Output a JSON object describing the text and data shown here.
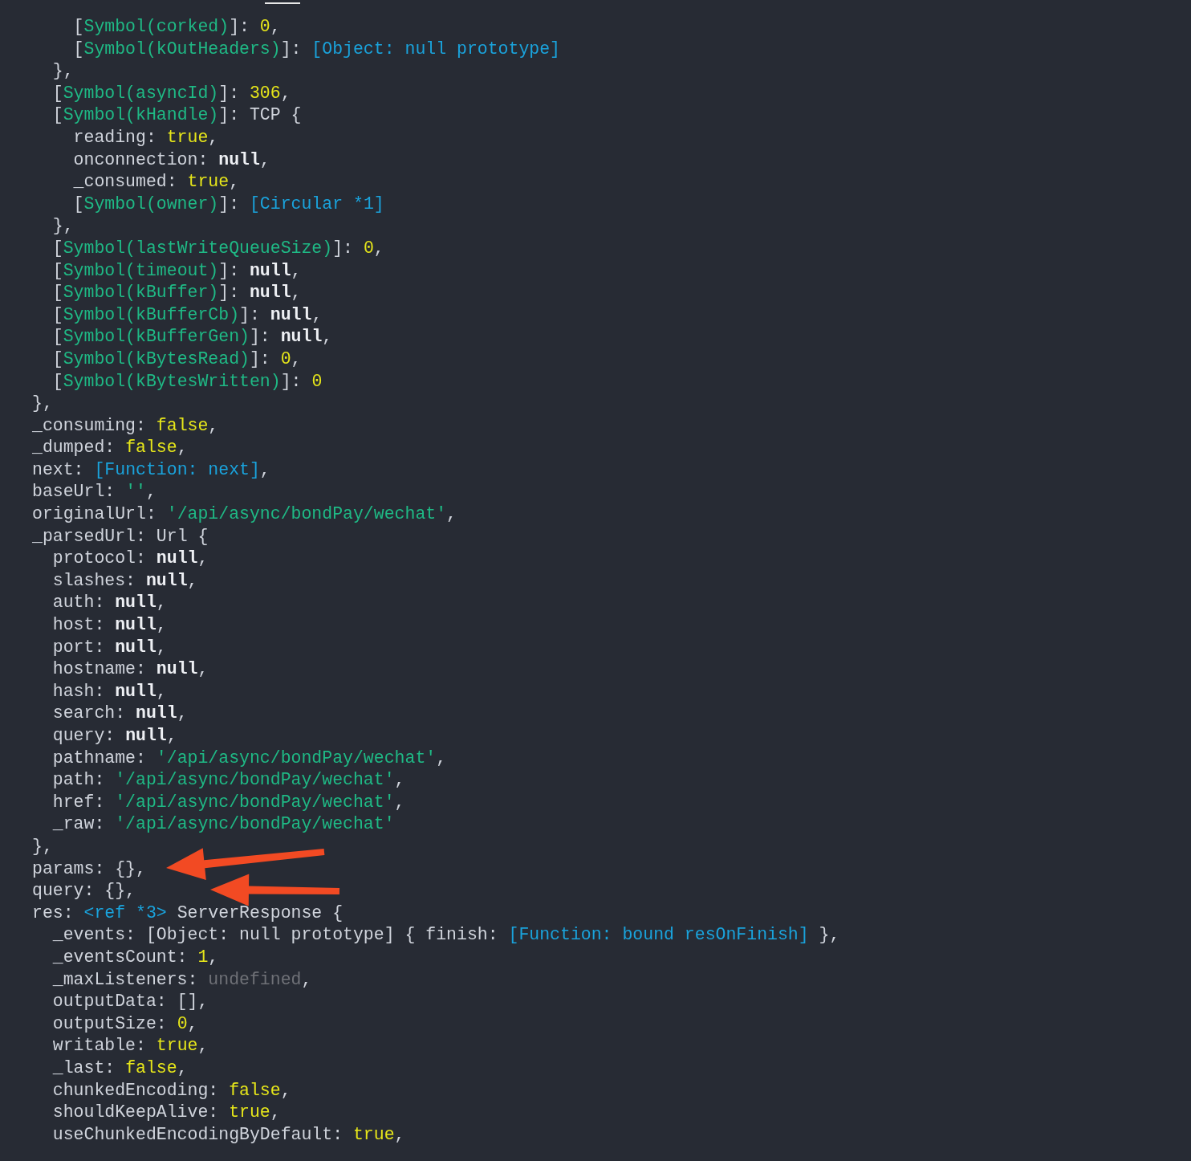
{
  "lines": [
    {
      "children": [
        {
          "children": [
            {
              "segments": [
                {
                  "kind": "plain",
                  "text": "["
                },
                {
                  "kind": "symbol",
                  "text": "Symbol(corked)"
                },
                {
                  "kind": "plain",
                  "text": "]: "
                },
                {
                  "kind": "number",
                  "text": "0"
                },
                {
                  "kind": "plain",
                  "text": ","
                }
              ]
            },
            {
              "segments": [
                {
                  "kind": "plain",
                  "text": "["
                },
                {
                  "kind": "symbol",
                  "text": "Symbol(kOutHeaders)"
                },
                {
                  "kind": "plain",
                  "text": "]: "
                },
                {
                  "kind": "special",
                  "text": "[Object: null prototype]"
                }
              ]
            }
          ]
        },
        {
          "segments": [
            {
              "kind": "plain",
              "text": "},"
            }
          ]
        },
        {
          "segments": [
            {
              "kind": "plain",
              "text": "["
            },
            {
              "kind": "symbol",
              "text": "Symbol(asyncId)"
            },
            {
              "kind": "plain",
              "text": "]: "
            },
            {
              "kind": "number",
              "text": "306"
            },
            {
              "kind": "plain",
              "text": ","
            }
          ]
        },
        {
          "segments": [
            {
              "kind": "plain",
              "text": "["
            },
            {
              "kind": "symbol",
              "text": "Symbol(kHandle)"
            },
            {
              "kind": "plain",
              "text": "]: TCP {"
            }
          ],
          "children": [
            {
              "segments": [
                {
                  "kind": "plain",
                  "text": "reading: "
                },
                {
                  "kind": "number",
                  "text": "true"
                },
                {
                  "kind": "plain",
                  "text": ","
                }
              ]
            },
            {
              "segments": [
                {
                  "kind": "plain",
                  "text": "onconnection: "
                },
                {
                  "kind": "null",
                  "text": "null"
                },
                {
                  "kind": "plain",
                  "text": ","
                }
              ]
            },
            {
              "segments": [
                {
                  "kind": "plain",
                  "text": "_consumed: "
                },
                {
                  "kind": "number",
                  "text": "true"
                },
                {
                  "kind": "plain",
                  "text": ","
                }
              ]
            },
            {
              "segments": [
                {
                  "kind": "plain",
                  "text": "["
                },
                {
                  "kind": "symbol",
                  "text": "Symbol(owner)"
                },
                {
                  "kind": "plain",
                  "text": "]: "
                },
                {
                  "kind": "special",
                  "text": "[Circular *1]"
                }
              ]
            }
          ]
        },
        {
          "segments": [
            {
              "kind": "plain",
              "text": "},"
            }
          ]
        },
        {
          "segments": [
            {
              "kind": "plain",
              "text": "["
            },
            {
              "kind": "symbol",
              "text": "Symbol(lastWriteQueueSize)"
            },
            {
              "kind": "plain",
              "text": "]: "
            },
            {
              "kind": "number",
              "text": "0"
            },
            {
              "kind": "plain",
              "text": ","
            }
          ]
        },
        {
          "segments": [
            {
              "kind": "plain",
              "text": "["
            },
            {
              "kind": "symbol",
              "text": "Symbol(timeout)"
            },
            {
              "kind": "plain",
              "text": "]: "
            },
            {
              "kind": "null",
              "text": "null"
            },
            {
              "kind": "plain",
              "text": ","
            }
          ]
        },
        {
          "segments": [
            {
              "kind": "plain",
              "text": "["
            },
            {
              "kind": "symbol",
              "text": "Symbol(kBuffer)"
            },
            {
              "kind": "plain",
              "text": "]: "
            },
            {
              "kind": "null",
              "text": "null"
            },
            {
              "kind": "plain",
              "text": ","
            }
          ]
        },
        {
          "segments": [
            {
              "kind": "plain",
              "text": "["
            },
            {
              "kind": "symbol",
              "text": "Symbol(kBufferCb)"
            },
            {
              "kind": "plain",
              "text": "]: "
            },
            {
              "kind": "null",
              "text": "null"
            },
            {
              "kind": "plain",
              "text": ","
            }
          ]
        },
        {
          "segments": [
            {
              "kind": "plain",
              "text": "["
            },
            {
              "kind": "symbol",
              "text": "Symbol(kBufferGen)"
            },
            {
              "kind": "plain",
              "text": "]: "
            },
            {
              "kind": "null",
              "text": "null"
            },
            {
              "kind": "plain",
              "text": ","
            }
          ]
        },
        {
          "segments": [
            {
              "kind": "plain",
              "text": "["
            },
            {
              "kind": "symbol",
              "text": "Symbol(kBytesRead)"
            },
            {
              "kind": "plain",
              "text": "]: "
            },
            {
              "kind": "number",
              "text": "0"
            },
            {
              "kind": "plain",
              "text": ","
            }
          ]
        },
        {
          "segments": [
            {
              "kind": "plain",
              "text": "["
            },
            {
              "kind": "symbol",
              "text": "Symbol(kBytesWritten)"
            },
            {
              "kind": "plain",
              "text": "]: "
            },
            {
              "kind": "number",
              "text": "0"
            }
          ]
        }
      ]
    },
    {
      "segments": [
        {
          "kind": "plain",
          "text": "},"
        }
      ]
    },
    {
      "segments": [
        {
          "kind": "plain",
          "text": "_consuming: "
        },
        {
          "kind": "number",
          "text": "false"
        },
        {
          "kind": "plain",
          "text": ","
        }
      ]
    },
    {
      "segments": [
        {
          "kind": "plain",
          "text": "_dumped: "
        },
        {
          "kind": "number",
          "text": "false"
        },
        {
          "kind": "plain",
          "text": ","
        }
      ]
    },
    {
      "segments": [
        {
          "kind": "plain",
          "text": "next: "
        },
        {
          "kind": "special",
          "text": "[Function: next]"
        },
        {
          "kind": "plain",
          "text": ","
        }
      ]
    },
    {
      "segments": [
        {
          "kind": "plain",
          "text": "baseUrl: "
        },
        {
          "kind": "string",
          "text": "''"
        },
        {
          "kind": "plain",
          "text": ","
        }
      ]
    },
    {
      "segments": [
        {
          "kind": "plain",
          "text": "originalUrl: "
        },
        {
          "kind": "string",
          "text": "'/api/async/bondPay/wechat'"
        },
        {
          "kind": "plain",
          "text": ","
        }
      ]
    },
    {
      "segments": [
        {
          "kind": "plain",
          "text": "_parsedUrl: Url {"
        }
      ],
      "children": [
        {
          "segments": [
            {
              "kind": "plain",
              "text": "protocol: "
            },
            {
              "kind": "null",
              "text": "null"
            },
            {
              "kind": "plain",
              "text": ","
            }
          ]
        },
        {
          "segments": [
            {
              "kind": "plain",
              "text": "slashes: "
            },
            {
              "kind": "null",
              "text": "null"
            },
            {
              "kind": "plain",
              "text": ","
            }
          ]
        },
        {
          "segments": [
            {
              "kind": "plain",
              "text": "auth: "
            },
            {
              "kind": "null",
              "text": "null"
            },
            {
              "kind": "plain",
              "text": ","
            }
          ]
        },
        {
          "segments": [
            {
              "kind": "plain",
              "text": "host: "
            },
            {
              "kind": "null",
              "text": "null"
            },
            {
              "kind": "plain",
              "text": ","
            }
          ]
        },
        {
          "segments": [
            {
              "kind": "plain",
              "text": "port: "
            },
            {
              "kind": "null",
              "text": "null"
            },
            {
              "kind": "plain",
              "text": ","
            }
          ]
        },
        {
          "segments": [
            {
              "kind": "plain",
              "text": "hostname: "
            },
            {
              "kind": "null",
              "text": "null"
            },
            {
              "kind": "plain",
              "text": ","
            }
          ]
        },
        {
          "segments": [
            {
              "kind": "plain",
              "text": "hash: "
            },
            {
              "kind": "null",
              "text": "null"
            },
            {
              "kind": "plain",
              "text": ","
            }
          ]
        },
        {
          "segments": [
            {
              "kind": "plain",
              "text": "search: "
            },
            {
              "kind": "null",
              "text": "null"
            },
            {
              "kind": "plain",
              "text": ","
            }
          ]
        },
        {
          "segments": [
            {
              "kind": "plain",
              "text": "query: "
            },
            {
              "kind": "null",
              "text": "null"
            },
            {
              "kind": "plain",
              "text": ","
            }
          ]
        },
        {
          "segments": [
            {
              "kind": "plain",
              "text": "pathname: "
            },
            {
              "kind": "string",
              "text": "'/api/async/bondPay/wechat'"
            },
            {
              "kind": "plain",
              "text": ","
            }
          ]
        },
        {
          "segments": [
            {
              "kind": "plain",
              "text": "path: "
            },
            {
              "kind": "string",
              "text": "'/api/async/bondPay/wechat'"
            },
            {
              "kind": "plain",
              "text": ","
            }
          ]
        },
        {
          "segments": [
            {
              "kind": "plain",
              "text": "href: "
            },
            {
              "kind": "string",
              "text": "'/api/async/bondPay/wechat'"
            },
            {
              "kind": "plain",
              "text": ","
            }
          ]
        },
        {
          "segments": [
            {
              "kind": "plain",
              "text": "_raw: "
            },
            {
              "kind": "string",
              "text": "'/api/async/bondPay/wechat'"
            }
          ]
        }
      ]
    },
    {
      "segments": [
        {
          "kind": "plain",
          "text": "},"
        }
      ]
    },
    {
      "segments": [
        {
          "kind": "plain",
          "text": "params: {},"
        }
      ]
    },
    {
      "segments": [
        {
          "kind": "plain",
          "text": "query: {},"
        }
      ]
    },
    {
      "segments": [
        {
          "kind": "plain",
          "text": "res: "
        },
        {
          "kind": "special",
          "text": "<ref *3>"
        },
        {
          "kind": "plain",
          "text": " ServerResponse {"
        }
      ],
      "children": [
        {
          "segments": [
            {
              "kind": "plain",
              "text": "_events: [Object: null prototype] { finish: "
            },
            {
              "kind": "special",
              "text": "[Function: bound resOnFinish]"
            },
            {
              "kind": "plain",
              "text": " },"
            }
          ]
        },
        {
          "segments": [
            {
              "kind": "plain",
              "text": "_eventsCount: "
            },
            {
              "kind": "number",
              "text": "1"
            },
            {
              "kind": "plain",
              "text": ","
            }
          ]
        },
        {
          "segments": [
            {
              "kind": "plain",
              "text": "_maxListeners: "
            },
            {
              "kind": "undefined",
              "text": "undefined"
            },
            {
              "kind": "plain",
              "text": ","
            }
          ]
        },
        {
          "segments": [
            {
              "kind": "plain",
              "text": "outputData: [],"
            }
          ]
        },
        {
          "segments": [
            {
              "kind": "plain",
              "text": "outputSize: "
            },
            {
              "kind": "number",
              "text": "0"
            },
            {
              "kind": "plain",
              "text": ","
            }
          ]
        },
        {
          "segments": [
            {
              "kind": "plain",
              "text": "writable: "
            },
            {
              "kind": "number",
              "text": "true"
            },
            {
              "kind": "plain",
              "text": ","
            }
          ]
        },
        {
          "segments": [
            {
              "kind": "plain",
              "text": "_last: "
            },
            {
              "kind": "number",
              "text": "false"
            },
            {
              "kind": "plain",
              "text": ","
            }
          ]
        },
        {
          "segments": [
            {
              "kind": "plain",
              "text": "chunkedEncoding: "
            },
            {
              "kind": "number",
              "text": "false"
            },
            {
              "kind": "plain",
              "text": ","
            }
          ]
        },
        {
          "segments": [
            {
              "kind": "plain",
              "text": "shouldKeepAlive: "
            },
            {
              "kind": "number",
              "text": "true"
            },
            {
              "kind": "plain",
              "text": ","
            }
          ]
        },
        {
          "segments": [
            {
              "kind": "plain",
              "text": "useChunkedEncodingByDefault: "
            },
            {
              "kind": "number",
              "text": "true"
            },
            {
              "kind": "plain",
              "text": ","
            }
          ]
        }
      ]
    }
  ]
}
